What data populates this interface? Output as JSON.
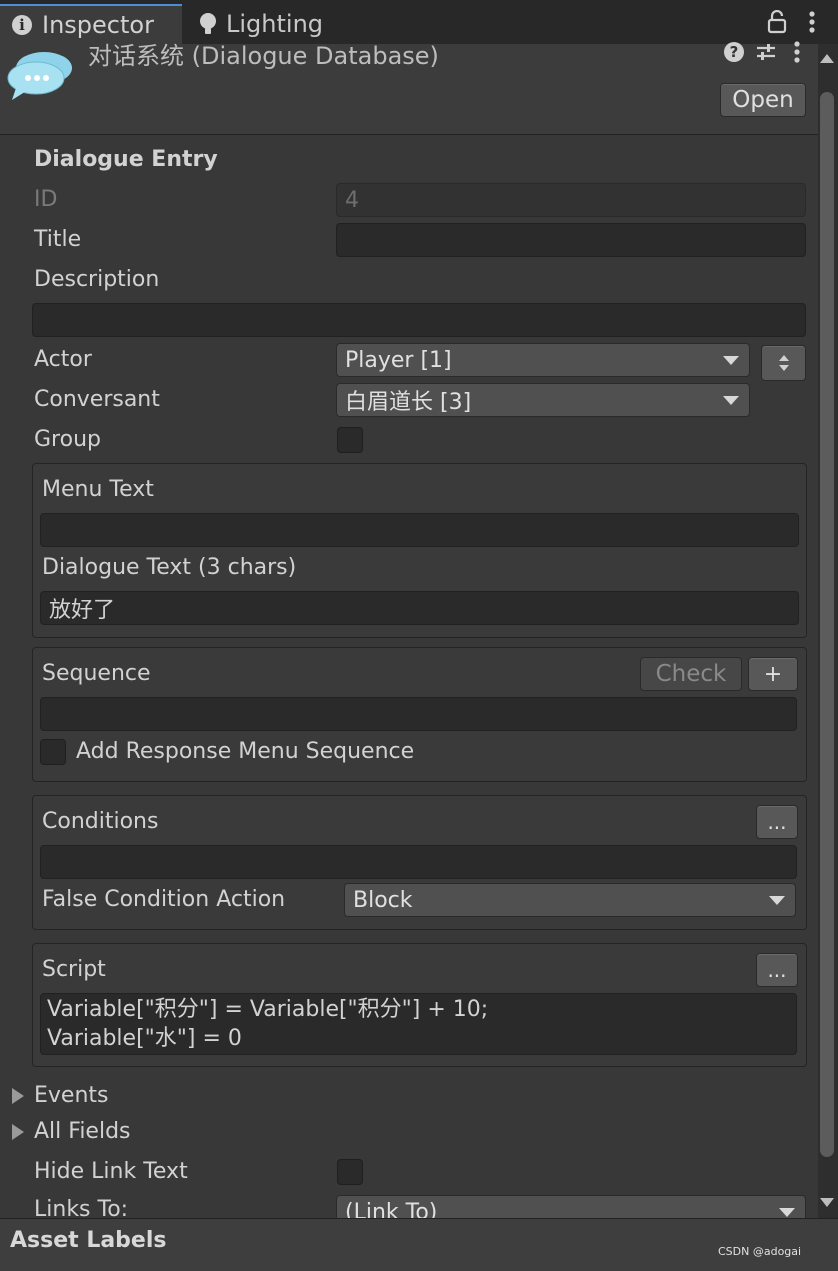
{
  "tabs": [
    {
      "label": "Inspector",
      "icon": "info-icon"
    },
    {
      "label": "Lighting",
      "icon": "light-bulb-icon"
    }
  ],
  "header": {
    "title": "对话系统 (Dialogue Database)",
    "open_label": "Open",
    "help_glyph": "?",
    "more_glyph": "⋮"
  },
  "entry": {
    "section_title": "Dialogue Entry",
    "id_label": "ID",
    "id_value": "4",
    "title_label": "Title",
    "title_value": "",
    "description_label": "Description",
    "description_value": "",
    "actor_label": "Actor",
    "actor_value": "Player [1]",
    "conversant_label": "Conversant",
    "conversant_value": "白眉道长 [3]",
    "group_label": "Group",
    "group_checked": false
  },
  "text_box": {
    "menu_text_label": "Menu Text",
    "menu_text_value": "",
    "dialogue_text_label": "Dialogue Text (3 chars)",
    "dialogue_text_value": "放好了"
  },
  "sequence_box": {
    "label": "Sequence",
    "check_label": "Check",
    "add_label": "+",
    "value": "",
    "add_response_label": "Add Response Menu Sequence",
    "add_response_checked": false
  },
  "conditions_box": {
    "label": "Conditions",
    "more_label": "...",
    "value": "",
    "false_action_label": "False Condition Action",
    "false_action_value": "Block"
  },
  "script_box": {
    "label": "Script",
    "more_label": "...",
    "line1": "Variable[\"积分\"] = Variable[\"积分\"] + 10;",
    "line2": "Variable[\"水\"] = 0"
  },
  "foldouts": {
    "events_label": "Events",
    "all_fields_label": "All Fields"
  },
  "links": {
    "hide_link_text_label": "Hide Link Text",
    "links_to_label": "Links To:",
    "links_to_value": "(Link To)"
  },
  "footer": {
    "asset_labels": "Asset Labels",
    "watermark": "CSDN @adogai"
  },
  "colors": {
    "background": "#383838",
    "field": "#2a2a2a",
    "button": "#585858",
    "tab_accent": "#4a8fd6",
    "bubble": "#8fd3ea"
  }
}
